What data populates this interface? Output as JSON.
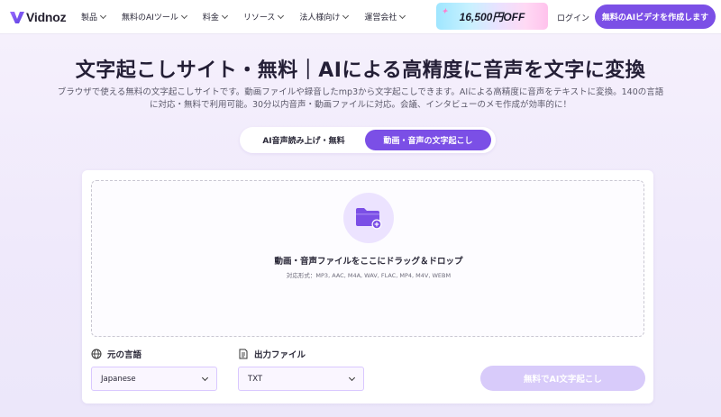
{
  "nav": {
    "logo_text": "Vidnoz",
    "menu": [
      {
        "label": "製品"
      },
      {
        "label": "無料のAIツール"
      },
      {
        "label": "料金"
      },
      {
        "label": "リソース"
      },
      {
        "label": "法人様向け"
      },
      {
        "label": "運営会社"
      }
    ],
    "promo_text": "16,500円OFF",
    "login_label": "ログイン",
    "cta_label": "無料のAIビデオを作成します"
  },
  "hero": {
    "title": "文字起こしサイト・無料｜AIによる高精度に音声を文字に変換",
    "description": "ブラウザで使える無料の文字起こしサイトです。動画ファイルや録音したmp3から文字起こしできます。AIによる高精度に音声をテキストに変換。140の言語に対応・無料で利用可能。30分以内音声・動画ファイルに対応。会議、インタビューのメモ作成が効率的に！"
  },
  "tabs": [
    {
      "label": "AI音声読み上げ・無料",
      "active": false
    },
    {
      "label": "動画・音声の文字起こし",
      "active": true
    }
  ],
  "upload": {
    "title": "動画・音声ファイルをここにドラッグ＆ドロップ",
    "formats": "対応形式：MP3, AAC, M4A, WAV, FLAC, MP4, M4V, WEBM"
  },
  "options": {
    "language_label": "元の言語",
    "language_value": "Japanese",
    "output_label": "出力ファイル",
    "output_value": "TXT"
  },
  "submit_label": "無料でAI文字起こし",
  "colors": {
    "accent": "#7b4fe6",
    "accent_light": "#ece3ff",
    "disabled_button": "#d8cbfa"
  }
}
